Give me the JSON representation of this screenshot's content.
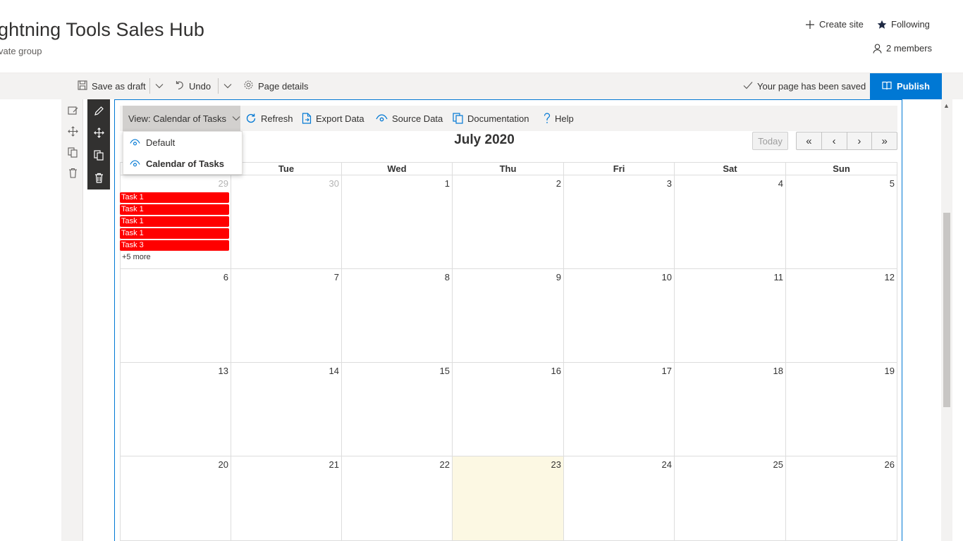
{
  "site": {
    "title": "ghtning Tools Sales Hub",
    "subtitle": "vate group",
    "create_site": "Create site",
    "following": "Following",
    "members": "2 members"
  },
  "commandbar": {
    "save_draft": "Save as draft",
    "undo": "Undo",
    "page_details": "Page details",
    "saved_status": "Your page has been saved",
    "publish": "Publish"
  },
  "app_toolbar": {
    "view": "View: Calendar of Tasks",
    "refresh": "Refresh",
    "export": "Export Data",
    "source": "Source Data",
    "documentation": "Documentation",
    "help": "Help"
  },
  "view_dropdown": {
    "options": [
      "Default",
      "Calendar of Tasks"
    ],
    "selected": "Calendar of Tasks"
  },
  "calendar": {
    "title": "July 2020",
    "today_label": "Today",
    "nav": [
      "«",
      "‹",
      "›",
      "»"
    ],
    "days_of_week": [
      "",
      "Tue",
      "Wed",
      "Thu",
      "Fri",
      "Sat",
      "Sun"
    ],
    "weeks": [
      [
        {
          "n": "29",
          "other": true
        },
        {
          "n": "30",
          "other": true
        },
        {
          "n": "1"
        },
        {
          "n": "2"
        },
        {
          "n": "3"
        },
        {
          "n": "4"
        },
        {
          "n": "5"
        }
      ],
      [
        {
          "n": "6"
        },
        {
          "n": "7"
        },
        {
          "n": "8"
        },
        {
          "n": "9"
        },
        {
          "n": "10"
        },
        {
          "n": "11"
        },
        {
          "n": "12"
        }
      ],
      [
        {
          "n": "13"
        },
        {
          "n": "14"
        },
        {
          "n": "15"
        },
        {
          "n": "16"
        },
        {
          "n": "17"
        },
        {
          "n": "18"
        },
        {
          "n": "19"
        }
      ],
      [
        {
          "n": "20"
        },
        {
          "n": "21"
        },
        {
          "n": "22"
        },
        {
          "n": "23",
          "today": true
        },
        {
          "n": "24"
        },
        {
          "n": "25"
        },
        {
          "n": "26"
        }
      ]
    ],
    "events": [
      "Task 1",
      "Task 1",
      "Task 1",
      "Task 1",
      "Task 3"
    ],
    "more_link": "+5 more",
    "event_color": "#ff0000",
    "today_color": "#fcf8e3"
  },
  "colors": {
    "accent": "#0078d4",
    "toolbar_dark": "#323130"
  }
}
